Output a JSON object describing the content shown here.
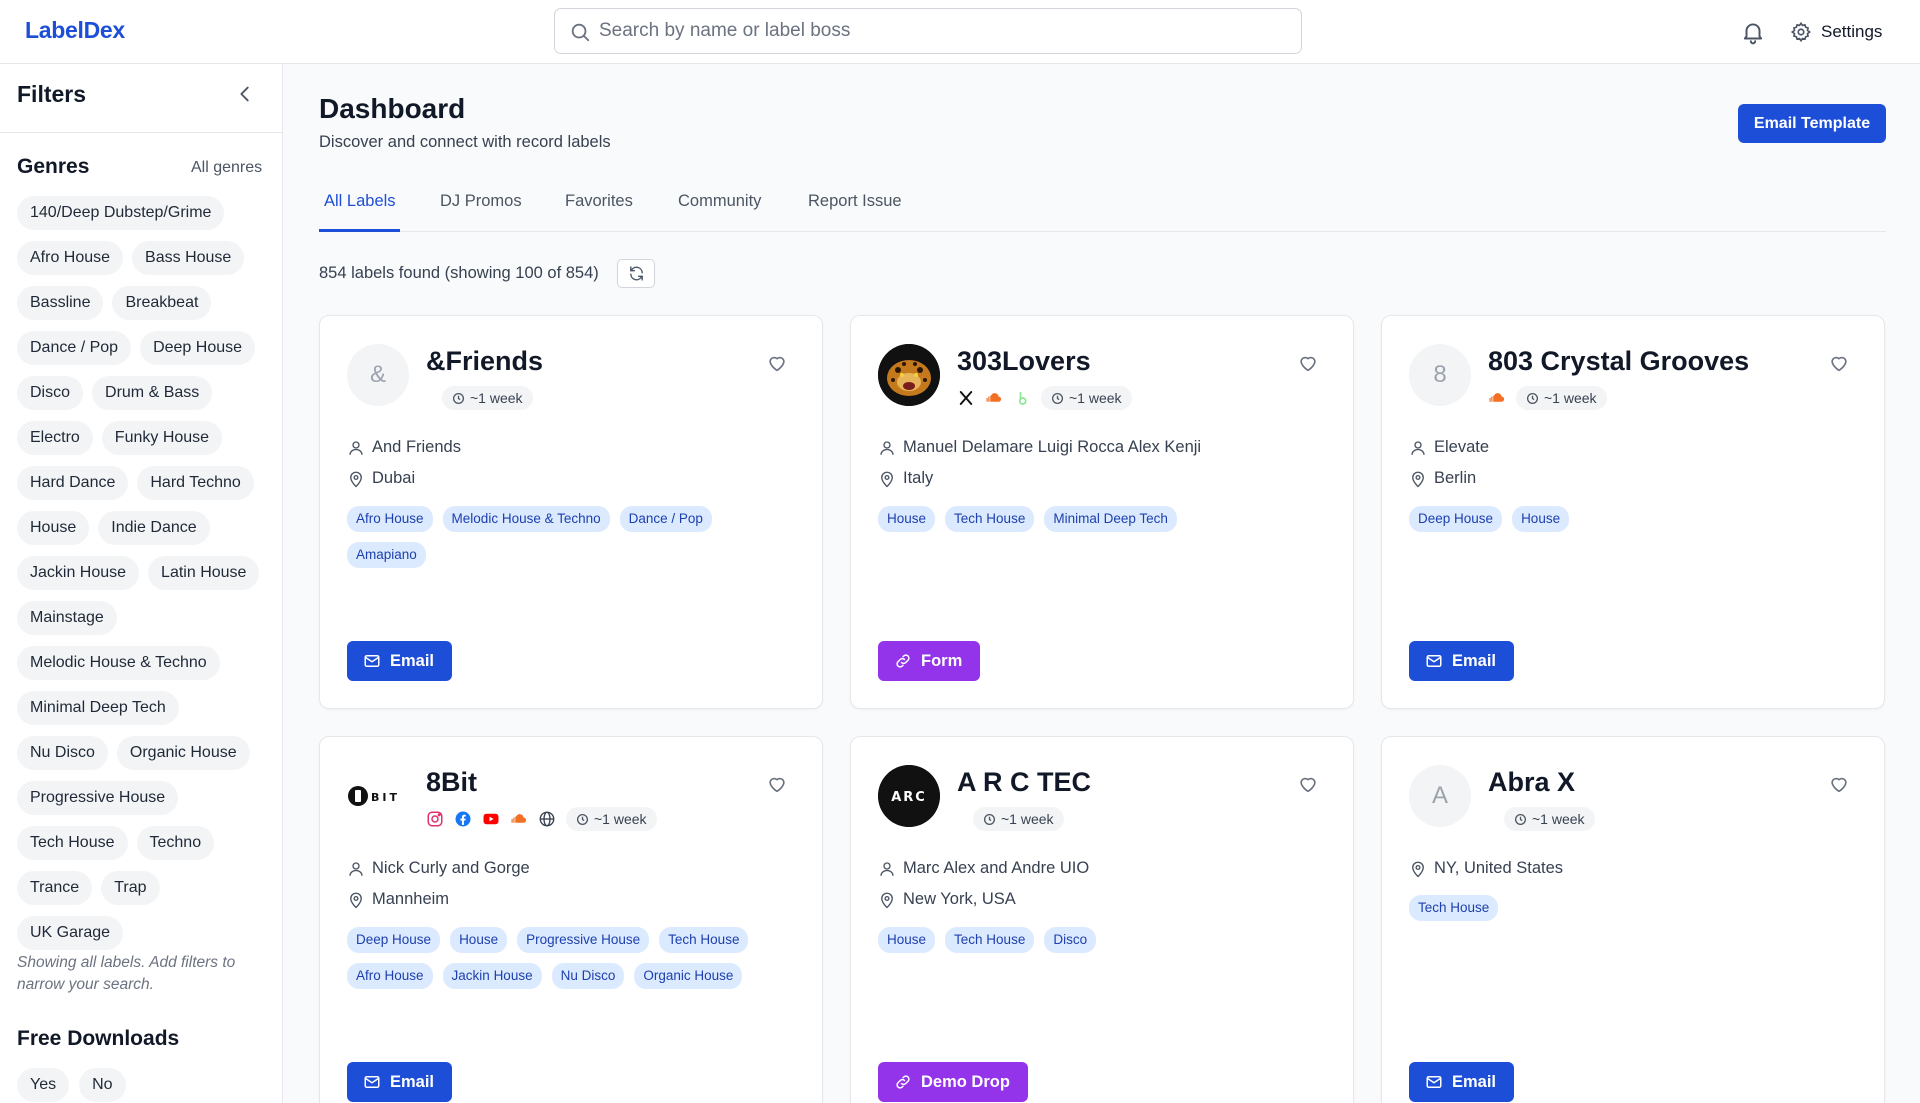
{
  "header": {
    "logo": "LabelDex",
    "search_placeholder": "Search by name or label boss",
    "settings_label": "Settings"
  },
  "sidebar": {
    "title": "Filters",
    "genres_title": "Genres",
    "all_genres": "All genres",
    "genres": [
      "140/Deep Dubstep/Grime",
      "Afro House",
      "Bass House",
      "Bassline",
      "Breakbeat",
      "Dance / Pop",
      "Deep House",
      "Disco",
      "Drum & Bass",
      "Electro",
      "Funky House",
      "Hard Dance",
      "Hard Techno",
      "House",
      "Indie Dance",
      "Jackin House",
      "Latin House",
      "Mainstage",
      "Melodic House & Techno",
      "Minimal Deep Tech",
      "Nu Disco",
      "Organic House",
      "Progressive House",
      "Tech House",
      "Techno",
      "Trance",
      "Trap",
      "UK Garage"
    ],
    "helper_text": "Showing all labels. Add filters to narrow your search.",
    "free_downloads_title": "Free Downloads",
    "free_downloads_options": [
      "Yes",
      "No"
    ]
  },
  "main": {
    "title": "Dashboard",
    "subtitle": "Discover and connect with record labels",
    "email_template_label": "Email Template",
    "tabs": [
      {
        "label": "All Labels"
      },
      {
        "label": "DJ Promos"
      },
      {
        "label": "Favorites"
      },
      {
        "label": "Community"
      },
      {
        "label": "Report Issue"
      }
    ],
    "results_text": "854 labels found (showing 100 of 854)"
  },
  "cards": [
    {
      "name": "&Friends",
      "avatar_letter": "&",
      "response": "~1 week",
      "boss": "And Friends",
      "location": "Dubai",
      "genres": [
        "Afro House",
        "Melodic House & Techno",
        "Dance / Pop",
        "Amapiano"
      ],
      "action": "Email"
    },
    {
      "name": "303Lovers",
      "avatar_letter": "",
      "response": "~1 week",
      "boss": "Manuel Delamare Luigi Rocca Alex Kenji",
      "location": "Italy",
      "genres": [
        "House",
        "Tech House",
        "Minimal Deep Tech"
      ],
      "action": "Form"
    },
    {
      "name": "803 Crystal Grooves",
      "avatar_letter": "8",
      "response": "~1 week",
      "boss": "Elevate",
      "location": "Berlin",
      "genres": [
        "Deep House",
        "House"
      ],
      "action": "Email"
    },
    {
      "name": "8Bit",
      "avatar_letter": "",
      "response": "~1 week",
      "boss": "Nick Curly and Gorge",
      "location": "Mannheim",
      "genres": [
        "Deep House",
        "House",
        "Progressive House",
        "Tech House",
        "Afro House",
        "Jackin House",
        "Nu Disco",
        "Organic House"
      ],
      "action": "Email"
    },
    {
      "name": "A R C TEC",
      "avatar_letter": "",
      "response": "~1 week",
      "boss": "Marc Alex and Andre UIO",
      "location": "New York, USA",
      "genres": [
        "House",
        "Tech House",
        "Disco"
      ],
      "action": "Demo Drop"
    },
    {
      "name": "Abra X",
      "avatar_letter": "A",
      "response": "~1 week",
      "boss": "",
      "location": "NY, United States",
      "genres": [
        "Tech House"
      ],
      "action": "Email"
    }
  ],
  "logos": {
    "bit_logo_text": "BIT",
    "arc_logo_text": "ARC"
  },
  "colors": {
    "accent": "#1d4ed8",
    "form_button": "#9333ea",
    "tag_bg": "#dbeafe",
    "tag_text": "#1e40af"
  }
}
